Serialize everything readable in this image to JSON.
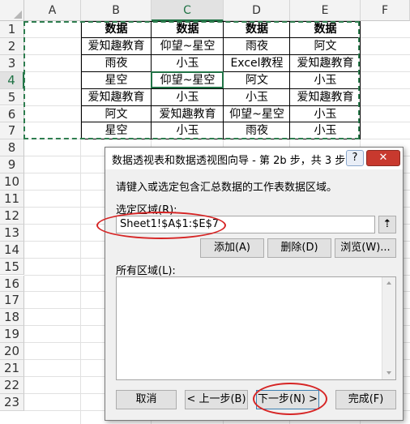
{
  "sheet": {
    "columns": [
      "A",
      "B",
      "C",
      "D",
      "E",
      "F"
    ],
    "rows": [
      "1",
      "2",
      "3",
      "4",
      "5",
      "6",
      "7",
      "8",
      "9",
      "10",
      "11",
      "12",
      "13",
      "14",
      "15",
      "16",
      "17",
      "18",
      "19",
      "20",
      "21",
      "22",
      "23"
    ],
    "table": [
      [
        "数据",
        "数据",
        "数据",
        "数据"
      ],
      [
        "爱知趣教育",
        "仰望~星空",
        "雨夜",
        "阿文"
      ],
      [
        "雨夜",
        "小玉",
        "Excel教程",
        "爱知趣教育"
      ],
      [
        "星空",
        "仰望~星空",
        "阿文",
        "小玉"
      ],
      [
        "爱知趣教育",
        "小玉",
        "小玉",
        "爱知趣教育"
      ],
      [
        "阿文",
        "爱知趣教育",
        "仰望~星空",
        "小玉"
      ],
      [
        "星空",
        "小玉",
        "雨夜",
        "小玉"
      ]
    ],
    "active_cell": "C4"
  },
  "dialog": {
    "title": "数据透视表和数据透视图向导 - 第 2b 步，共 3 步",
    "help_label": "?",
    "close_label": "✕",
    "instruction": "请键入或选定包含汇总数据的工作表数据区域。",
    "range_label": "选定区域(R):",
    "range_value": "Sheet1!$A$1:$E$7",
    "collapse_label": "⇡",
    "add_label": "添加(A)",
    "delete_label": "删除(D)",
    "browse_label": "浏览(W)...",
    "all_ranges_label": "所有区域(L):",
    "cancel_label": "取消",
    "back_label": "< 上一步(B)",
    "next_label": "下一步(N) >",
    "finish_label": "完成(F)",
    "highlight_color": "#d62424"
  }
}
